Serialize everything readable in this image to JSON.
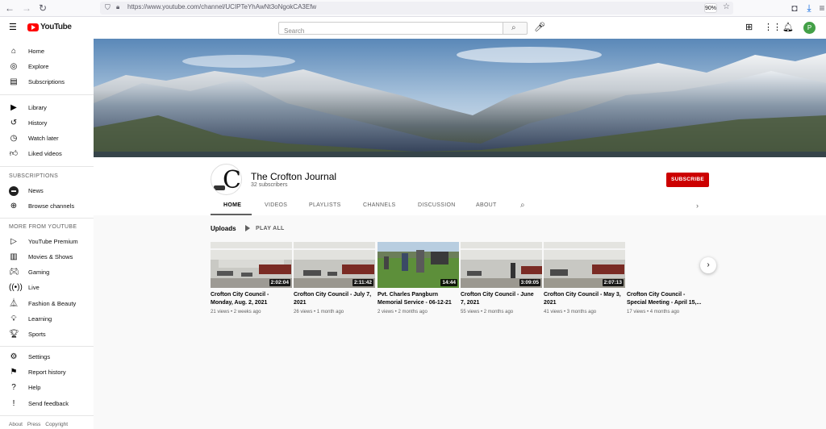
{
  "browser": {
    "url": "https://www.youtube.com/channel/UCIPTeYhAwNt3oNgokCA3Efw",
    "zoom": "90%"
  },
  "header": {
    "logo_text": "YouTube",
    "search_placeholder": "Search",
    "avatar_letter": "P"
  },
  "sidebar": {
    "main": [
      {
        "label": "Home",
        "icon": "home-icon"
      },
      {
        "label": "Explore",
        "icon": "compass-icon"
      },
      {
        "label": "Subscriptions",
        "icon": "subscriptions-icon"
      }
    ],
    "library": [
      {
        "label": "Library",
        "icon": "library-icon"
      },
      {
        "label": "History",
        "icon": "history-icon"
      },
      {
        "label": "Watch later",
        "icon": "clock-icon"
      },
      {
        "label": "Liked videos",
        "icon": "thumbs-up-icon"
      }
    ],
    "subscriptions_heading": "SUBSCRIPTIONS",
    "subscriptions": [
      {
        "label": "News",
        "icon": "news-icon"
      },
      {
        "label": "Browse channels",
        "icon": "plus-circle-icon"
      }
    ],
    "more_heading": "MORE FROM YOUTUBE",
    "more": [
      {
        "label": "YouTube Premium",
        "icon": "youtube-premium-icon"
      },
      {
        "label": "Movies & Shows",
        "icon": "film-icon"
      },
      {
        "label": "Gaming",
        "icon": "gamepad-icon"
      },
      {
        "label": "Live",
        "icon": "live-icon"
      },
      {
        "label": "Fashion & Beauty",
        "icon": "hanger-icon"
      },
      {
        "label": "Learning",
        "icon": "bulb-icon"
      },
      {
        "label": "Sports",
        "icon": "trophy-icon"
      }
    ],
    "settings": [
      {
        "label": "Settings",
        "icon": "gear-icon"
      },
      {
        "label": "Report history",
        "icon": "flag-icon"
      },
      {
        "label": "Help",
        "icon": "help-icon"
      },
      {
        "label": "Send feedback",
        "icon": "feedback-icon"
      }
    ],
    "footer": [
      "About",
      "Press",
      "Copyright"
    ]
  },
  "channel": {
    "name": "The Crofton Journal",
    "subscribers": "32 subscribers",
    "subscribe_label": "SUBSCRIBE",
    "tabs": [
      "HOME",
      "VIDEOS",
      "PLAYLISTS",
      "CHANNELS",
      "DISCUSSION",
      "ABOUT"
    ]
  },
  "uploads": {
    "title": "Uploads",
    "play_all": "PLAY ALL",
    "videos": [
      {
        "title": "Crofton City Council - Monday, Aug. 2, 2021",
        "duration": "2:02:04",
        "views": "21 views",
        "age": "2 weeks ago"
      },
      {
        "title": "Crofton City Council - July 7, 2021",
        "duration": "2:11:42",
        "views": "26 views",
        "age": "1 month ago"
      },
      {
        "title": "Pvt. Charles Pangburn Memorial Service - 06-12-21",
        "duration": "14:44",
        "views": "2 views",
        "age": "2 months ago"
      },
      {
        "title": "Crofton City Council - June 7, 2021",
        "duration": "3:09:05",
        "views": "55 views",
        "age": "2 months ago"
      },
      {
        "title": "Crofton City Council - May 3, 2021",
        "duration": "2:07:13",
        "views": "41 views",
        "age": "3 months ago"
      },
      {
        "title": "Crofton City Council - Special Meeting - April 15,...",
        "duration": "",
        "views": "17 views",
        "age": "4 months ago"
      }
    ]
  }
}
